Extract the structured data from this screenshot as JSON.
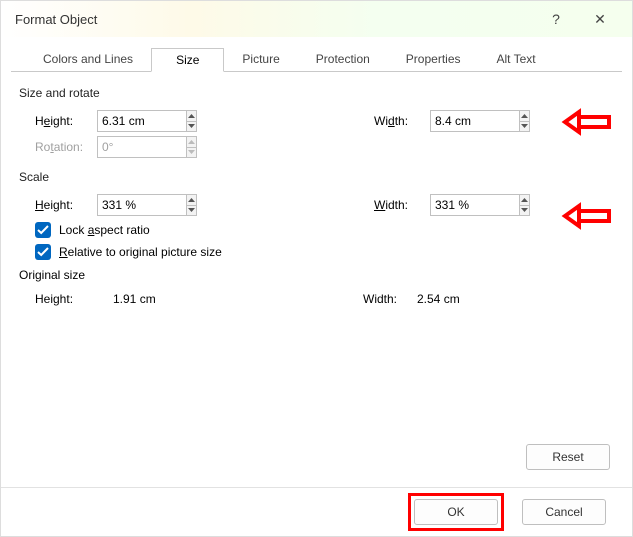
{
  "titlebar": {
    "title": "Format Object",
    "help_label": "?",
    "close_label": "✕"
  },
  "tabs": {
    "colors_lines": "Colors and Lines",
    "size": "Size",
    "picture": "Picture",
    "protection": "Protection",
    "properties": "Properties",
    "alt_text": "Alt Text"
  },
  "size_rotate": {
    "group_label": "Size and rotate",
    "height_label_ul": "e",
    "height_label_rest": "ight:",
    "height_label_pre": "H",
    "height_value": "6.31 cm",
    "width_label_pre": "Wi",
    "width_label_ul": "d",
    "width_label_rest": "th:",
    "width_value": "8.4 cm",
    "rotation_label_pre": "Ro",
    "rotation_label_ul": "t",
    "rotation_label_rest": "ation:",
    "rotation_value": "0°"
  },
  "scale": {
    "group_label": "Scale",
    "height_label_ul": "H",
    "height_label_rest": "eight:",
    "height_value": "331 %",
    "width_label_ul": "W",
    "width_label_rest": "idth:",
    "width_value": "331 %",
    "lock_pre": "Lock ",
    "lock_ul": "a",
    "lock_rest": "spect ratio",
    "rel_ul": "R",
    "rel_rest": "elative to original picture size"
  },
  "original": {
    "group_label": "Original size",
    "height_label": "Height:",
    "height_value": "1.91 cm",
    "width_label": "Width:",
    "width_value": "2.54 cm"
  },
  "buttons": {
    "reset": "Reset",
    "ok": "OK",
    "cancel": "Cancel"
  }
}
